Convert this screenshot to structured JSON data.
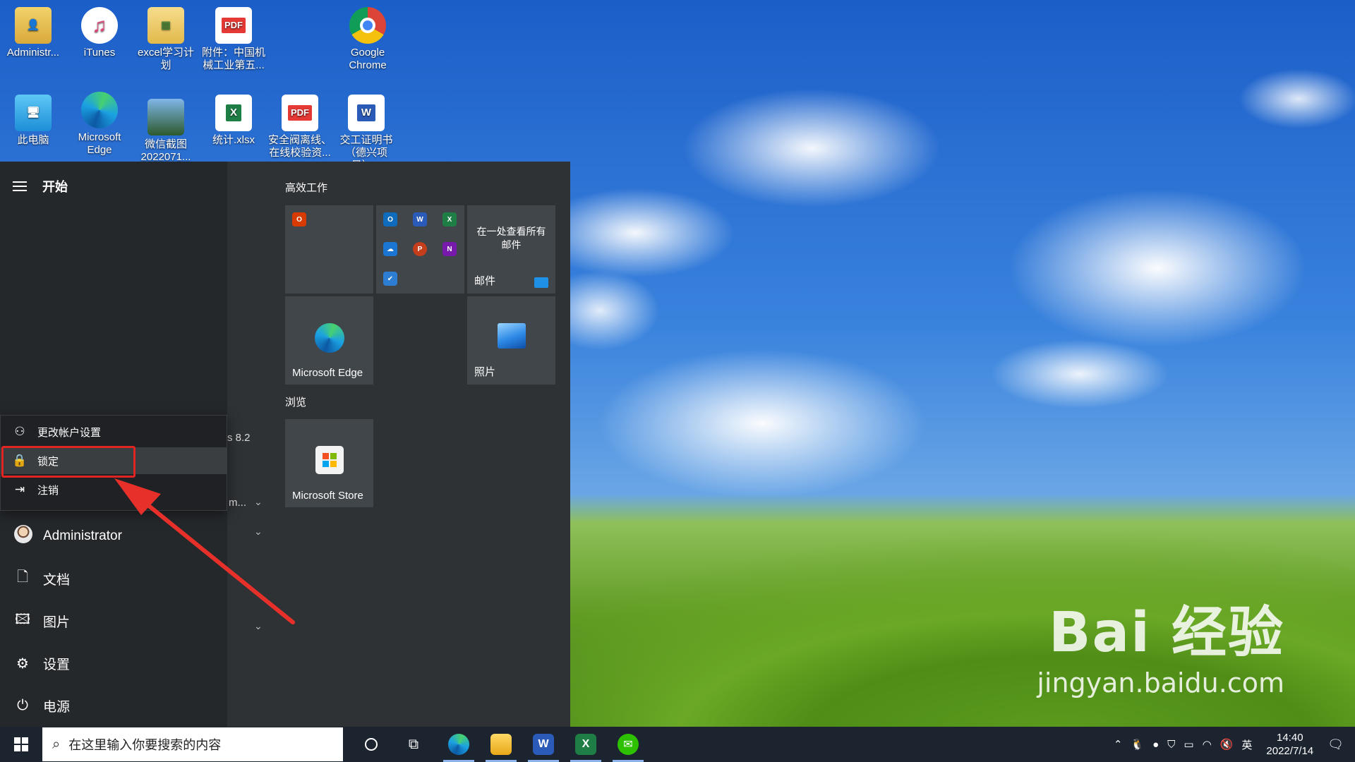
{
  "desktop": {
    "icons": [
      {
        "label": "Administr...",
        "icon": "user-folder-icon"
      },
      {
        "label": "iTunes",
        "icon": "itunes-icon"
      },
      {
        "label": "excel学习计划",
        "icon": "folder-icon"
      },
      {
        "label": "附件：中国机械工业第五...",
        "icon": "pdf-icon"
      },
      {
        "label": "Google Chrome",
        "icon": "chrome-icon"
      },
      {
        "label": "此电脑",
        "icon": "this-pc-icon"
      },
      {
        "label": "Microsoft Edge",
        "icon": "edge-icon"
      },
      {
        "label": "微信截图 2022071...",
        "icon": "image-icon"
      },
      {
        "label": "统计.xlsx",
        "icon": "excel-file-icon"
      },
      {
        "label": "安全阀离线、在线校验资...",
        "icon": "pdf-icon"
      },
      {
        "label": "交工证明书（德兴项目）...",
        "icon": "word-file-icon"
      }
    ],
    "watermark": {
      "main": "Bai 经验",
      "sub": "jingyan.baidu.com"
    }
  },
  "start_menu": {
    "title": "开始",
    "user": "Administrator",
    "left_items": [
      {
        "label": "文档",
        "icon": "document-icon"
      },
      {
        "label": "图片",
        "icon": "pictures-icon"
      },
      {
        "label": "设置",
        "icon": "gear-icon"
      },
      {
        "label": "电源",
        "icon": "power-icon"
      }
    ],
    "account_flyout": [
      {
        "label": "更改帐户设置",
        "icon": "account-settings-icon"
      },
      {
        "label": "锁定",
        "icon": "lock-icon"
      },
      {
        "label": "注销",
        "icon": "sign-out-icon"
      }
    ],
    "partial_apps": [
      "s 8.2",
      "m..."
    ],
    "groups": [
      {
        "title": "高效工作"
      },
      {
        "title": "浏览"
      }
    ],
    "tiles": {
      "mail_text": "在一处查看所有邮件",
      "mail_label": "邮件",
      "edge_label": "Microsoft Edge",
      "photos_label": "照片",
      "store_label": "Microsoft Store"
    }
  },
  "taskbar": {
    "search_placeholder": "在这里输入你要搜索的内容",
    "time": "14:40",
    "date": "2022/7/14",
    "ime": "英"
  },
  "colors": {
    "annotation": "#e02424",
    "taskbar": "#1c2430"
  }
}
